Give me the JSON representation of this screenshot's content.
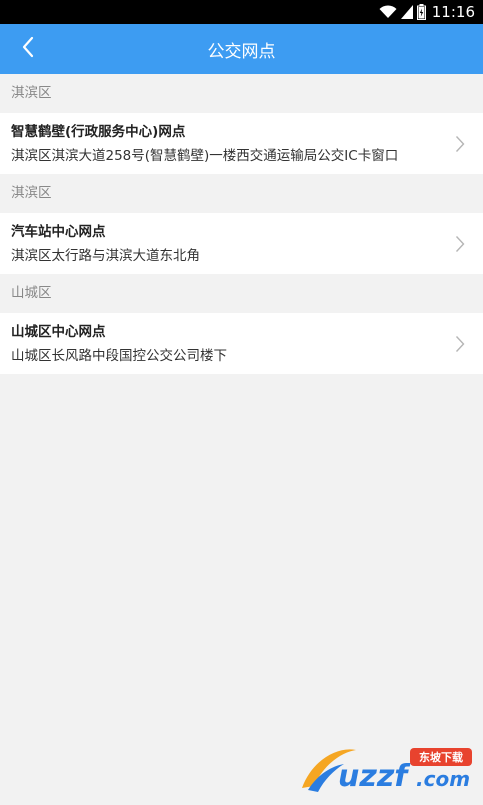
{
  "status_bar": {
    "time": "11:16",
    "icons": [
      "wifi-icon",
      "signal-icon",
      "battery-icon"
    ]
  },
  "header": {
    "title": "公交网点",
    "back_icon": "chevron-left-icon",
    "color": "#3d9cf2"
  },
  "sections": [
    {
      "label": "淇滨区",
      "items": [
        {
          "name": "智慧鹤壁(行政服务中心)网点",
          "address": "淇滨区淇滨大道258号(智慧鹤壁)一楼西交通运输局公交IC卡窗口"
        }
      ]
    },
    {
      "label": "淇滨区",
      "items": [
        {
          "name": "汽车站中心网点",
          "address": "淇滨区太行路与淇滨大道东北角"
        }
      ]
    },
    {
      "label": "山城区",
      "items": [
        {
          "name": "山城区中心网点",
          "address": "山城区长风路中段国控公交公司楼下"
        }
      ]
    }
  ],
  "watermark": {
    "logo_text": "uzzf.com",
    "badge_text": "东坡下载"
  }
}
